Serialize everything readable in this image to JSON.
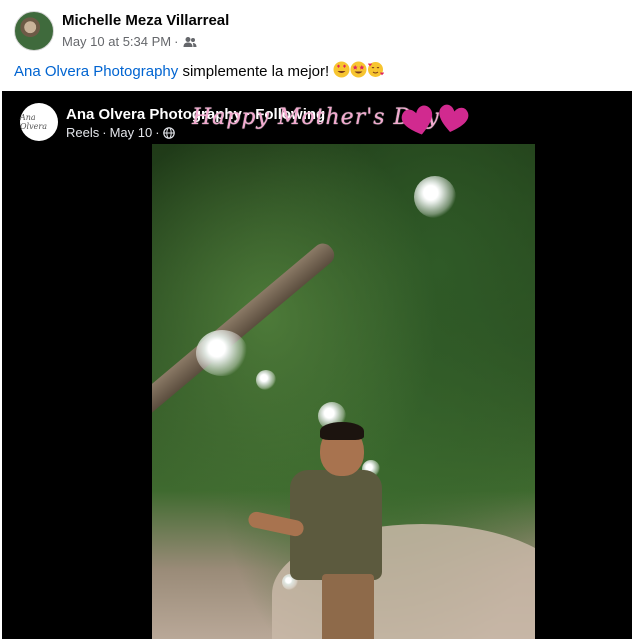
{
  "post": {
    "author_name": "Michelle Meza Villarreal",
    "timestamp": "May 10 at 5:34 PM",
    "separator": "·",
    "audience_icon": "friends-icon",
    "text": {
      "mention": "Ana Olvera Photography",
      "body": " simplemente la mejor!",
      "emojis": [
        "heart-eyes-emoji",
        "star-struck-emoji",
        "smiling-hearts-emoji"
      ]
    }
  },
  "reel": {
    "page_name": "Ana Olvera Photography",
    "separator": " · ",
    "follow_status": "Following",
    "type_label": "Reels",
    "date": "May 10",
    "meta_separator": "·",
    "privacy_icon": "globe-icon",
    "overlay_text": "Happy Mother's Day",
    "avatar_text": "Ana Olvera"
  }
}
